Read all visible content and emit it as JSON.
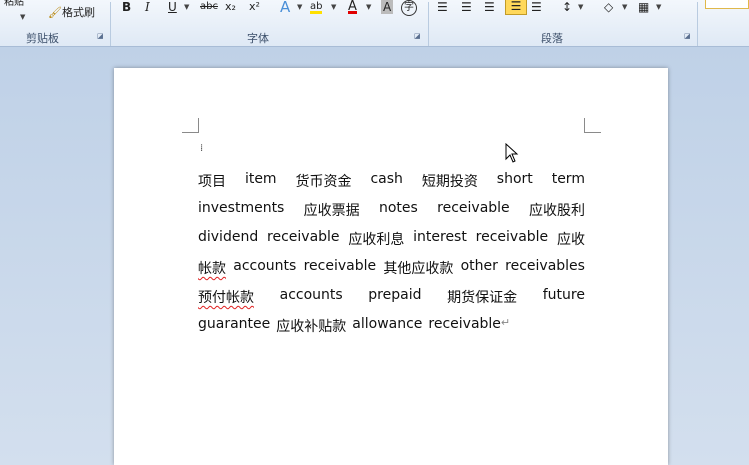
{
  "ribbon": {
    "clipboard": {
      "top_text": "粘贴",
      "format_painter": "格式刷",
      "group_label": "剪贴板"
    },
    "font": {
      "bold": "B",
      "italic": "I",
      "underline": "U",
      "strike": "abc",
      "subscript": "x₂",
      "superscript": "x²",
      "text_effect": "A",
      "highlight": "ab",
      "font_color": "A",
      "char_shade": "A",
      "enclose": "字",
      "group_label": "字体"
    },
    "paragraph": {
      "group_label": "段落"
    }
  },
  "document": {
    "lines": [
      [
        "项目",
        "item",
        "货币资金",
        "cash",
        "短期投资",
        "short",
        "term"
      ],
      [
        "investments",
        "应收票据",
        "notes",
        "receivable",
        "应收股利"
      ],
      [
        "dividend",
        "receivable",
        "应收利息",
        "interest",
        "receivable",
        "应收"
      ],
      [
        "帐款",
        "accounts",
        "receivable",
        "其他应收款",
        "other",
        "receivables"
      ],
      [
        "预付帐款",
        "accounts",
        "prepaid",
        "期货保证金",
        "future"
      ],
      [
        "guarantee",
        "应收补贴款",
        "allowance",
        "receivable"
      ]
    ],
    "paragraph_mark": "↵"
  }
}
